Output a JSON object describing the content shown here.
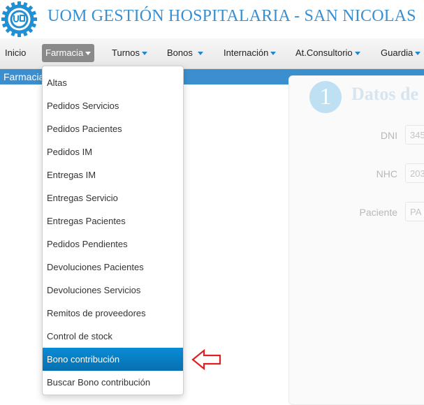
{
  "header": {
    "title": "UOM GESTIÓN HOSPITALARIA - SAN NICOLAS"
  },
  "colors": {
    "brand": "#3a8fd0",
    "section_bar": "#3b8fce",
    "highlight": "#0a8bd6",
    "active_nav": "#8a8a8a",
    "annotation_arrow": "#e02020"
  },
  "nav": {
    "items": [
      {
        "label": "Inicio"
      },
      {
        "label": "Farmacia"
      },
      {
        "label": "Turnos"
      },
      {
        "label": "Bonos"
      },
      {
        "label": "Internación"
      },
      {
        "label": "At.Consultorio"
      },
      {
        "label": "Guardia"
      }
    ],
    "active": "Farmacia"
  },
  "section": {
    "title": "Farmacia"
  },
  "form": {
    "step_number": "1",
    "step_title": "Datos de",
    "fields": [
      {
        "label": "DNI",
        "value": "345"
      },
      {
        "label": "NHC",
        "value": "203"
      },
      {
        "label": "Paciente",
        "value": "PA"
      }
    ]
  },
  "dropdown": {
    "items": [
      {
        "label": "Altas"
      },
      {
        "label": "Pedidos Servicios"
      },
      {
        "label": "Pedidos Pacientes"
      },
      {
        "label": "Pedidos IM"
      },
      {
        "label": "Entregas IM"
      },
      {
        "label": "Entregas Servicio"
      },
      {
        "label": "Entregas Pacientes"
      },
      {
        "label": "Pedidos Pendientes"
      },
      {
        "label": "Devoluciones Pacientes"
      },
      {
        "label": "Devoluciones Servicios"
      },
      {
        "label": "Remitos de proveedores"
      },
      {
        "label": "Control de stock"
      },
      {
        "label": "Bono contribución"
      },
      {
        "label": "Buscar Bono contribución"
      }
    ],
    "highlighted": "Bono contribución"
  },
  "icons": {
    "logo": "uom-logo-icon",
    "caret": "caret-down-icon",
    "annotation": "left-arrow-icon"
  }
}
